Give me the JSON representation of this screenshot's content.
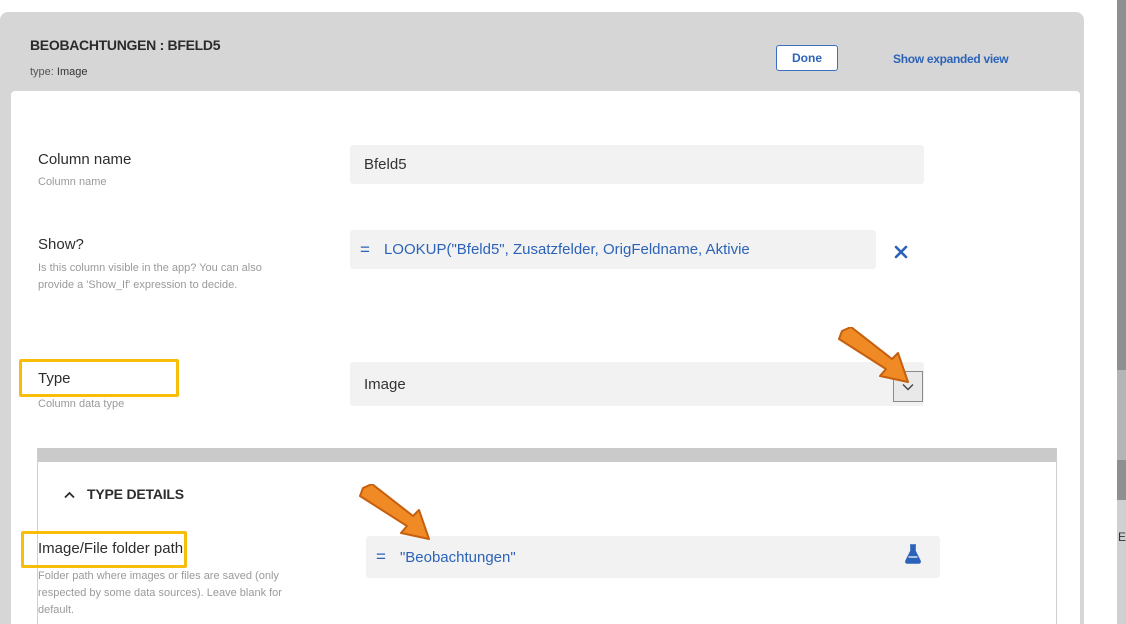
{
  "dialog": {
    "title": "BEOBACHTUNGEN : BFELD5",
    "type_prefix": "type:",
    "type_value": "Image",
    "done_label": "Done",
    "expanded_label": "Show expanded view"
  },
  "fields": {
    "column_name": {
      "label": "Column name",
      "hint": "Column name",
      "value": "Bfeld5"
    },
    "show": {
      "label": "Show?",
      "hint": "Is this column visible in the app? You can also provide a 'Show_If' expression to decide.",
      "eq": "=",
      "value": "LOOKUP(\"Bfeld5\", Zusatzfelder, OrigFeldname, Aktivie"
    },
    "type": {
      "label": "Type",
      "hint": "Column data type",
      "value": "Image"
    }
  },
  "type_details": {
    "header": "TYPE DETAILS",
    "folder_path": {
      "label": "Image/File folder path",
      "hint": "Folder path where images or files are saved (only respected by some data sources). Leave blank for default.",
      "eq": "=",
      "value": "\"Beobachtungen\""
    }
  },
  "background": {
    "edge_letter": "E"
  },
  "colors": {
    "accent": "#2c63b9",
    "highlight": "#f7bd08",
    "arrow": "#f08a24"
  },
  "icons": {
    "clear": "close-icon",
    "dropdown": "chevron-down-icon",
    "collapse": "chevron-up-icon",
    "test": "flask-icon"
  }
}
